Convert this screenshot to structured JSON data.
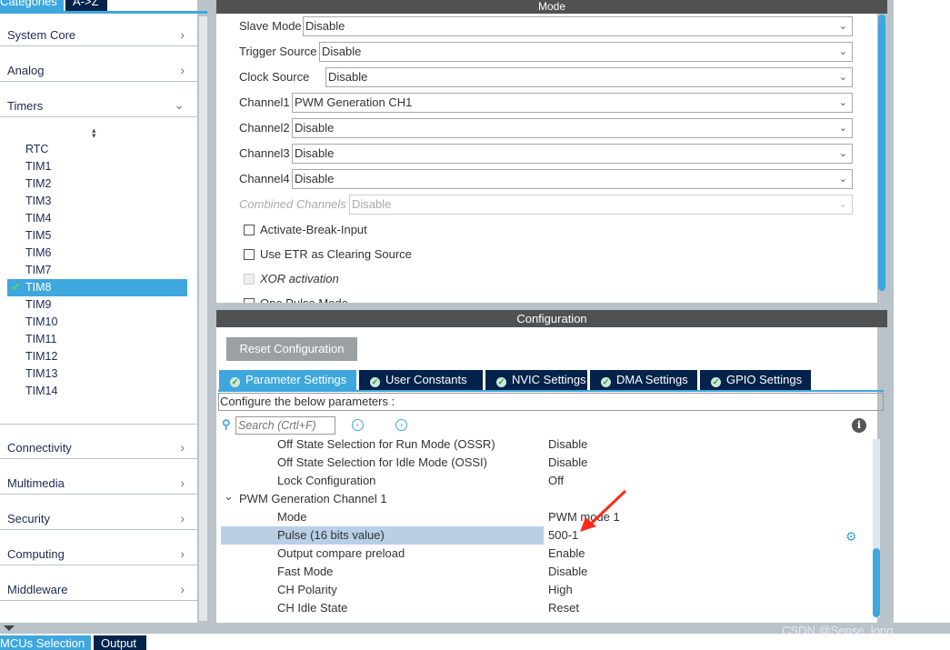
{
  "left_panel": {
    "tabs": [
      {
        "label": "Categories",
        "active": true
      },
      {
        "label": "A->Z",
        "active": false
      }
    ],
    "categories_top": [
      {
        "label": "System Core",
        "icon": "chevron-right"
      },
      {
        "label": "Analog",
        "icon": "chevron-right"
      },
      {
        "label": "Timers",
        "icon": "chevron-down"
      }
    ],
    "timers": [
      "RTC",
      "TIM1",
      "TIM2",
      "TIM3",
      "TIM4",
      "TIM5",
      "TIM6",
      "TIM7",
      "TIM8",
      "TIM9",
      "TIM10",
      "TIM11",
      "TIM12",
      "TIM13",
      "TIM14"
    ],
    "selected_timer": "TIM8",
    "categories_bottom": [
      {
        "label": "Connectivity"
      },
      {
        "label": "Multimedia"
      },
      {
        "label": "Security"
      },
      {
        "label": "Computing"
      },
      {
        "label": "Middleware"
      }
    ]
  },
  "bottom_tabs": [
    {
      "label": "MCUs Selection",
      "active": true
    },
    {
      "label": "Output",
      "active": false
    }
  ],
  "mode": {
    "title": "Mode",
    "fields": [
      {
        "label": "Slave Mode",
        "value": "Disable"
      },
      {
        "label": "Trigger Source",
        "value": "Disable"
      },
      {
        "label": "Clock Source",
        "value": "Disable"
      },
      {
        "label": "Channel1",
        "value": "PWM Generation CH1"
      },
      {
        "label": "Channel2",
        "value": "Disable"
      },
      {
        "label": "Channel3",
        "value": "Disable"
      },
      {
        "label": "Channel4",
        "value": "Disable"
      },
      {
        "label": "Combined Channels",
        "value": "Disable",
        "disabled": true
      }
    ],
    "checkboxes": [
      {
        "label": "Activate-Break-Input",
        "checked": false
      },
      {
        "label": "Use ETR as Clearing Source",
        "checked": false
      },
      {
        "label": "XOR activation",
        "checked": false,
        "disabled": true
      },
      {
        "label": "One Pulse Mode",
        "checked": false
      }
    ]
  },
  "configuration": {
    "title": "Configuration",
    "reset_label": "Reset Configuration",
    "tabs": [
      "Parameter Settings",
      "User Constants",
      "NVIC Settings",
      "DMA Settings",
      "GPIO Settings"
    ],
    "active_tab": "Parameter Settings",
    "hint": "Configure the below parameters :",
    "search_placeholder": "Search (Crtl+F)",
    "rows_before": [
      {
        "name": "Off State Selection for Run Mode (OSSR)",
        "value": "Disable"
      },
      {
        "name": "Off State Selection for Idle Mode (OSSI)",
        "value": "Disable"
      },
      {
        "name": "Lock Configuration",
        "value": "Off"
      }
    ],
    "group": "PWM Generation Channel 1",
    "rows": [
      {
        "name": "Mode",
        "value": "PWM mode 1"
      },
      {
        "name": "Pulse (16 bits value)",
        "value": "500-1",
        "selected": true
      },
      {
        "name": "Output compare preload",
        "value": "Enable"
      },
      {
        "name": "Fast Mode",
        "value": "Disable"
      },
      {
        "name": "CH Polarity",
        "value": "High"
      },
      {
        "name": "CH Idle State",
        "value": "Reset"
      }
    ]
  },
  "watermark": "CSDN @Sense_long",
  "colors": {
    "accent": "#3ea7dd",
    "navy": "#03234b",
    "header": "#4f5152",
    "annotation": "#ff2a1a"
  }
}
